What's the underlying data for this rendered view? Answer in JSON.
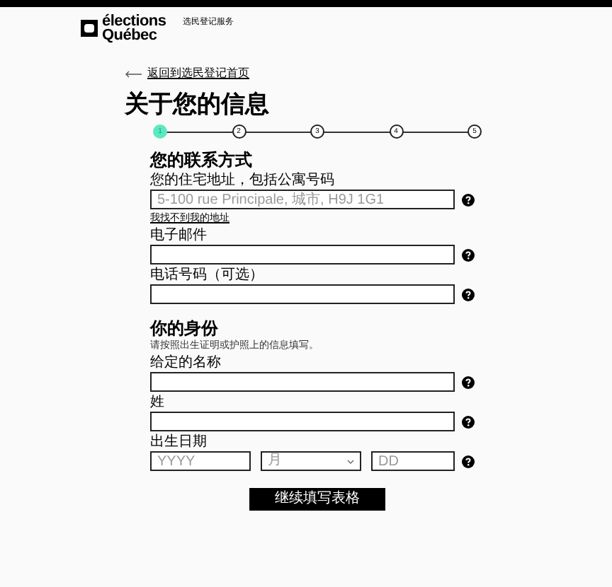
{
  "header": {
    "logo_line_1": "élections",
    "logo_line_2": "Québec",
    "tagline": "选民登记服务"
  },
  "back_link": "返回到选民登记首页",
  "title": "关于您的信息",
  "steps": [
    {
      "label": "1",
      "selected": true
    },
    {
      "label": "2",
      "selected": false
    },
    {
      "label": "3",
      "selected": false
    },
    {
      "label": "4",
      "selected": false
    },
    {
      "label": "5",
      "selected": false
    }
  ],
  "sections": [
    {
      "heading": "您的联系方式",
      "fields": [
        {
          "kind": "text",
          "label": "您的住宅地址，包括公寓号码",
          "placeholder": "5-100 rue Principale, 城市, H9J 1G1",
          "link": "我找不到我的地址"
        },
        {
          "kind": "text",
          "label": "电子邮件"
        },
        {
          "kind": "text",
          "label": "电话号码（可选）"
        }
      ]
    },
    {
      "heading": "你的身份",
      "description": "请按照出生证明或护照上的信息填写。",
      "fields": [
        {
          "kind": "text",
          "label": "给定的名称"
        },
        {
          "kind": "text",
          "label": "姓"
        },
        {
          "kind": "date",
          "label": "出生日期",
          "year_placeholder": "YYYY",
          "month_placeholder": "月",
          "day_placeholder": "DD"
        }
      ]
    }
  ],
  "submit_button": "继续填写表格"
}
